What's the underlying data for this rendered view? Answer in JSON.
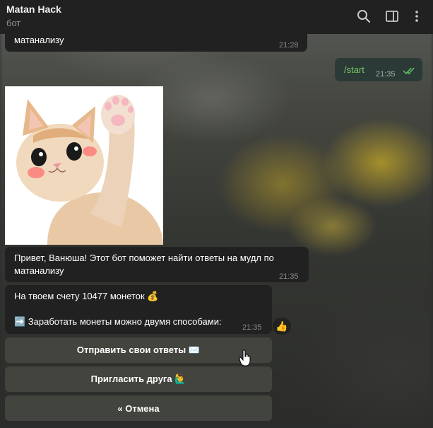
{
  "header": {
    "title": "Matan Hack",
    "subtitle": "бот",
    "icons": [
      "search-icon",
      "sidebar-toggle-icon",
      "more-vert-icon"
    ]
  },
  "messages": {
    "prev_tail": {
      "text": "матанализу",
      "time": "21:28"
    },
    "start": {
      "text": "/start",
      "time": "21:35"
    },
    "greeting": {
      "text": "Привет, Ванюша! Этот бот поможет найти ответы на мудл по матанализу",
      "time": "21:35"
    },
    "balance": {
      "line1": "На твоем счету 10477 монеток 💰",
      "line2": "➡️ Заработать монеты можно двумя способами:",
      "time": "21:35",
      "reaction": "👍"
    }
  },
  "keyboard": {
    "send_answers": "Отправить свои ответы ✉️",
    "invite_friend": "Пригласить друга 🙋‍♂️",
    "cancel": "« Отмена"
  },
  "colors": {
    "header_bg": "#212121",
    "bubble_bg": "#212121",
    "outgoing_bg": "#2b3a36",
    "command": "#76c46a",
    "read_check": "#5fbf62"
  }
}
